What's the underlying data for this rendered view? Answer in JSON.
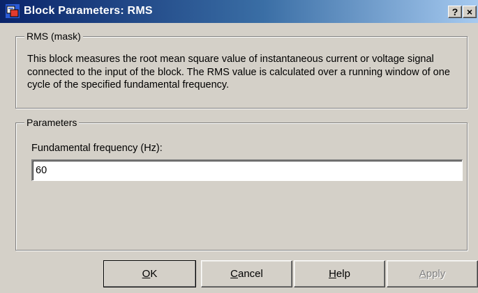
{
  "window": {
    "title": "Block Parameters: RMS",
    "help_glyph": "?",
    "close_glyph": "×",
    "app_icon": "simulink-block-icon"
  },
  "mask_group": {
    "label": "RMS (mask)",
    "description": "This block measures the root mean square value of instantaneous current or voltage signal connected to the input of the block. The RMS value is calculated over a running window of one cycle of the specified fundamental frequency."
  },
  "params_group": {
    "label": "Parameters",
    "frequency_label": "Fundamental frequency (Hz):",
    "frequency_value": "60"
  },
  "buttons": {
    "ok": {
      "mnemonic": "O",
      "rest": "K"
    },
    "cancel": {
      "mnemonic": "C",
      "rest": "ancel"
    },
    "help": {
      "mnemonic": "H",
      "rest": "elp"
    },
    "apply": {
      "mnemonic": "A",
      "rest": "pply",
      "enabled": false
    }
  },
  "colors": {
    "titlebar_start": "#0a246a",
    "titlebar_end": "#a6caf0",
    "dialog_face": "#d4d0c8",
    "disabled_text": "#808080"
  }
}
